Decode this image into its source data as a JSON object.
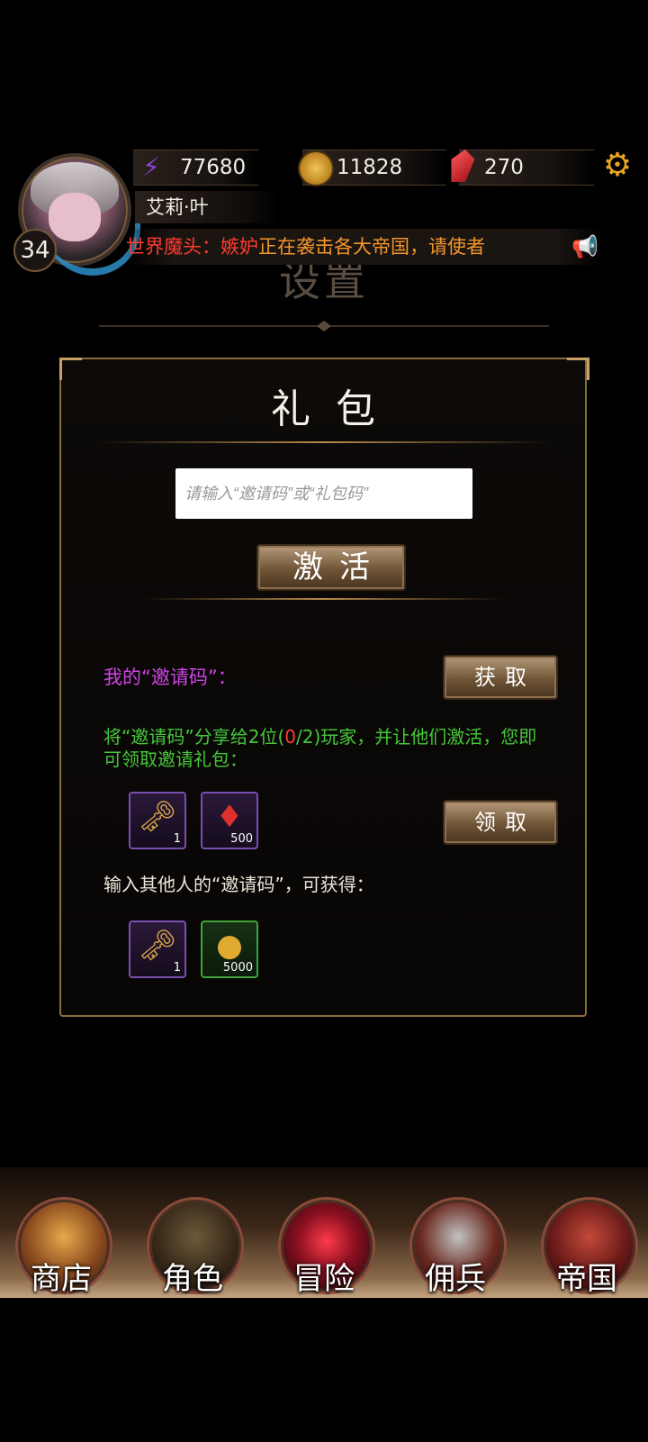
{
  "header": {
    "level": "34",
    "player_name": "艾莉·叶",
    "resources": {
      "energy": "77680",
      "gold": "11828",
      "gems": "270"
    },
    "ticker": {
      "prefix": "世界魔头：",
      "boss_name": "嫉妒",
      "message": "正在袭击各大帝国，请使者"
    },
    "background_title": "设置",
    "icons": {
      "energy": "lightning-icon",
      "gold": "coin-icon",
      "gems": "gem-icon",
      "settings": "gear-icon",
      "ticker": "megaphone-icon"
    }
  },
  "panel": {
    "title": "礼包",
    "code_input_placeholder": "请输入“邀请码”或“礼包码”",
    "activate_label": "激活",
    "my_code_label": "我的“邀请码”：",
    "get_label": "获取",
    "share_text_before": "将“邀请码”分享给2位(",
    "share_count": "0",
    "share_text_after": "/2)玩家，并让他们激活，您即可领取邀请礼包：",
    "claim_label": "领取",
    "enter_text": "输入其他人的“邀请码”，可获得：",
    "invite_rewards": [
      {
        "icon": "keys-icon",
        "count": "1"
      },
      {
        "icon": "red-gem-icon",
        "count": "500"
      }
    ],
    "enter_rewards": [
      {
        "icon": "key-icon",
        "count": "1"
      },
      {
        "icon": "gold-coin-icon",
        "count": "5000"
      }
    ]
  },
  "nav": {
    "items": [
      {
        "label": "商店"
      },
      {
        "label": "角色"
      },
      {
        "label": "冒险"
      },
      {
        "label": "佣兵"
      },
      {
        "label": "帝国"
      }
    ]
  },
  "colors": {
    "ticker_red": "#ff3b2f",
    "ticker_orange": "#f2962a",
    "my_code_purple": "#cf45e6",
    "share_green": "#45c73b",
    "panel_gold": "#8b6b3f"
  }
}
